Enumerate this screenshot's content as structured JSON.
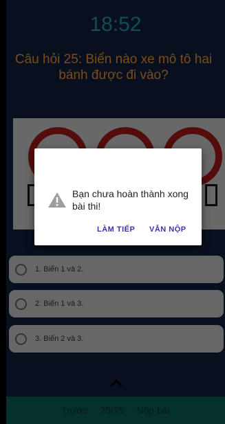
{
  "timer": "18:52",
  "question": {
    "line1": "Câu hỏi 25: Biển nào xe mô tô hai",
    "line2": "bánh được đi vào?"
  },
  "answers": [
    {
      "label": "1. Biển 1 và 2."
    },
    {
      "label": "2. Biển 1 và 3."
    },
    {
      "label": "3. Biển 2 và 3."
    }
  ],
  "nav": {
    "prev_label": "Trước",
    "progress": "25/25",
    "submit_label": "Nộp bài"
  },
  "dialog": {
    "message": "Bạn chưa hoàn thành xong bài thi!",
    "continue_label": "LÀM TIẾP",
    "submit_label": "VẪN NỘP",
    "icon": "warning-icon"
  },
  "colors": {
    "background": "#0d1a33",
    "timer": "#1f7a8b",
    "question": "#c97b22",
    "bottom_bar": "#075046",
    "dialog_button": "#3b33a8"
  }
}
